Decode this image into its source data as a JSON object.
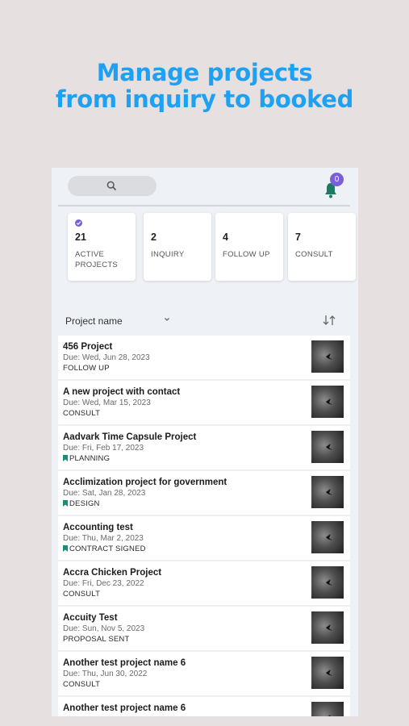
{
  "headline": {
    "line1": "Manage projects",
    "line2": "from inquiry to booked"
  },
  "topbar": {
    "search_icon": "search-icon",
    "bell_icon": "bell-icon",
    "notification_count": "0"
  },
  "summary_cards": [
    {
      "count": "21",
      "label": "ACTIVE PROJECTS",
      "selected": true
    },
    {
      "count": "2",
      "label": "INQUIRY",
      "selected": false
    },
    {
      "count": "4",
      "label": "FOLLOW UP",
      "selected": false
    },
    {
      "count": "7",
      "label": "CONSULT",
      "selected": false
    }
  ],
  "sort": {
    "label": "Project name",
    "chevron_icon": "chevron-down-icon",
    "toggle_icon": "sort-arrows-icon"
  },
  "projects": [
    {
      "name": "456 Project",
      "due": "Due: Wed, Jun 28, 2023",
      "stage": "FOLLOW UP",
      "bookmarked": false
    },
    {
      "name": "A new project with contact",
      "due": "Due: Wed, Mar 15, 2023",
      "stage": "CONSULT",
      "bookmarked": false
    },
    {
      "name": "Aadvark Time Capsule Project",
      "due": "Due: Fri, Feb 17, 2023",
      "stage": "PLANNING",
      "bookmarked": true
    },
    {
      "name": "Acclimization project for government",
      "due": "Due: Sat, Jan 28, 2023",
      "stage": "DESIGN",
      "bookmarked": true
    },
    {
      "name": "Accounting test",
      "due": "Due: Thu, Mar 2, 2023",
      "stage": "CONTRACT SIGNED",
      "bookmarked": true
    },
    {
      "name": "Accra Chicken Project",
      "due": "Due: Fri, Dec 23, 2022",
      "stage": "CONSULT",
      "bookmarked": false
    },
    {
      "name": "Accuity Test",
      "due": "Due: Sun, Nov 5, 2023",
      "stage": "PROPOSAL SENT",
      "bookmarked": false
    },
    {
      "name": "Another test project name 6",
      "due": "Due: Thu, Jun 30, 2022",
      "stage": "CONSULT",
      "bookmarked": false
    },
    {
      "name": "Another test project name 6",
      "due": "",
      "stage": "",
      "bookmarked": false
    }
  ],
  "colors": {
    "accent": "#1ea1f2",
    "purple": "#7b5fd8",
    "bell": "#1f7a64",
    "bookmark": "#1a8c78"
  }
}
